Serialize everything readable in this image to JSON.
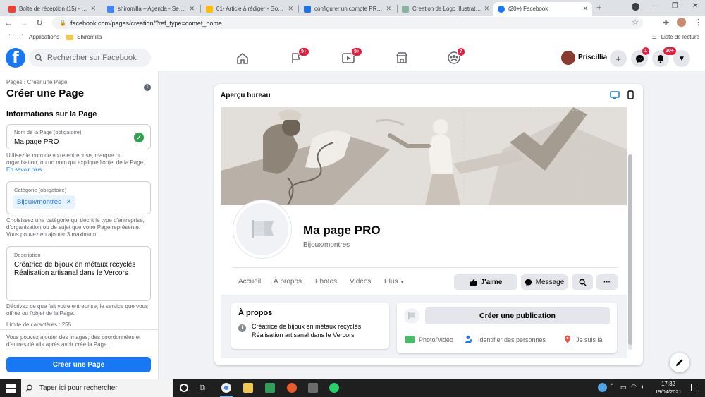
{
  "browser": {
    "tabs": [
      {
        "title": "Boîte de réception (15) - conta",
        "color": "#ea4335",
        "glyph": "M"
      },
      {
        "title": "shiromilla – Agenda - Semaine",
        "color": "#4285f4",
        "glyph": "31"
      },
      {
        "title": "01- Article à rédiger - Google",
        "color": "#fbbc04",
        "glyph": "▲"
      },
      {
        "title": "configurer un compte PRO sur",
        "color": "#1a73e8",
        "glyph": "▤"
      },
      {
        "title": "Creation de Logo Illustration |",
        "color": "#8ab4a0",
        "glyph": "▣"
      },
      {
        "title": "(20+) Facebook",
        "color": "#1877f2",
        "glyph": "f"
      }
    ],
    "new_tab": "+",
    "url": "facebook.com/pages/creation/?ref_type=comet_home",
    "bookmarks": {
      "apps": "Applications",
      "folder": "Shiromilla",
      "reading_list": "Liste de lecture"
    }
  },
  "fb_header": {
    "logo": "f",
    "search_placeholder": "Rechercher sur Facebook",
    "flag_badge": "9+",
    "watch_badge": "9+",
    "groups_badge": "7",
    "profile_name": "Priscillia",
    "messenger_badge": "1",
    "notif_badge": "20+"
  },
  "left": {
    "breadcrumb": "Pages › Créer une Page",
    "title": "Créer une Page",
    "section_title": "Informations sur la Page",
    "name_label": "Nom de la Page (obligatoire)",
    "name_value": "Ma page PRO",
    "name_help": "Utilisez le nom de votre entreprise, marque ou organisation, ou un nom qui explique l'objet de la Page.",
    "learn_more": "En savoir plus",
    "category_label": "Catégorie (obligatoire)",
    "category_chip": "Bijoux/montres",
    "category_help": "Choisissez une catégorie qui décrit le type d'entreprise, d'organisation ou de sujet que votre Page représente. Vous pouvez en ajouter 3 maximum.",
    "description_label": "Description",
    "description_line1": "Créatrice de bijoux en métaux recyclés",
    "description_line2": "Réalisation artisanal dans le Vercors",
    "description_help": "Décrivez ce que fait votre entreprise, le service que vous offrez ou l'objet de la Page.",
    "char_limit": "Limite de caractères : 255",
    "footer_note": "Vous pouvez ajouter des images, des coordonnées et d'autres détails après avoir créé la Page.",
    "create_button": "Créer une Page"
  },
  "preview": {
    "title": "Aperçu bureau",
    "page_name": "Ma page PRO",
    "page_category": "Bijoux/montres",
    "tabs": [
      "Accueil",
      "À propos",
      "Photos",
      "Vidéos",
      "Plus"
    ],
    "like_button": "J'aime",
    "message_button": "Message",
    "more_button": "···",
    "about_title": "À propos",
    "about_line1": "Créatrice de bijoux en métaux recyclés",
    "about_line2": "Réalisation artisanal dans le Vercors",
    "create_post": "Créer une publication",
    "photo_video": "Photo/Vidéo",
    "tag_people": "Identifier des personnes",
    "check_in": "Je suis là"
  },
  "taskbar": {
    "search_placeholder": "Taper ici pour rechercher",
    "time": "17:32",
    "date": "19/04/2021"
  }
}
